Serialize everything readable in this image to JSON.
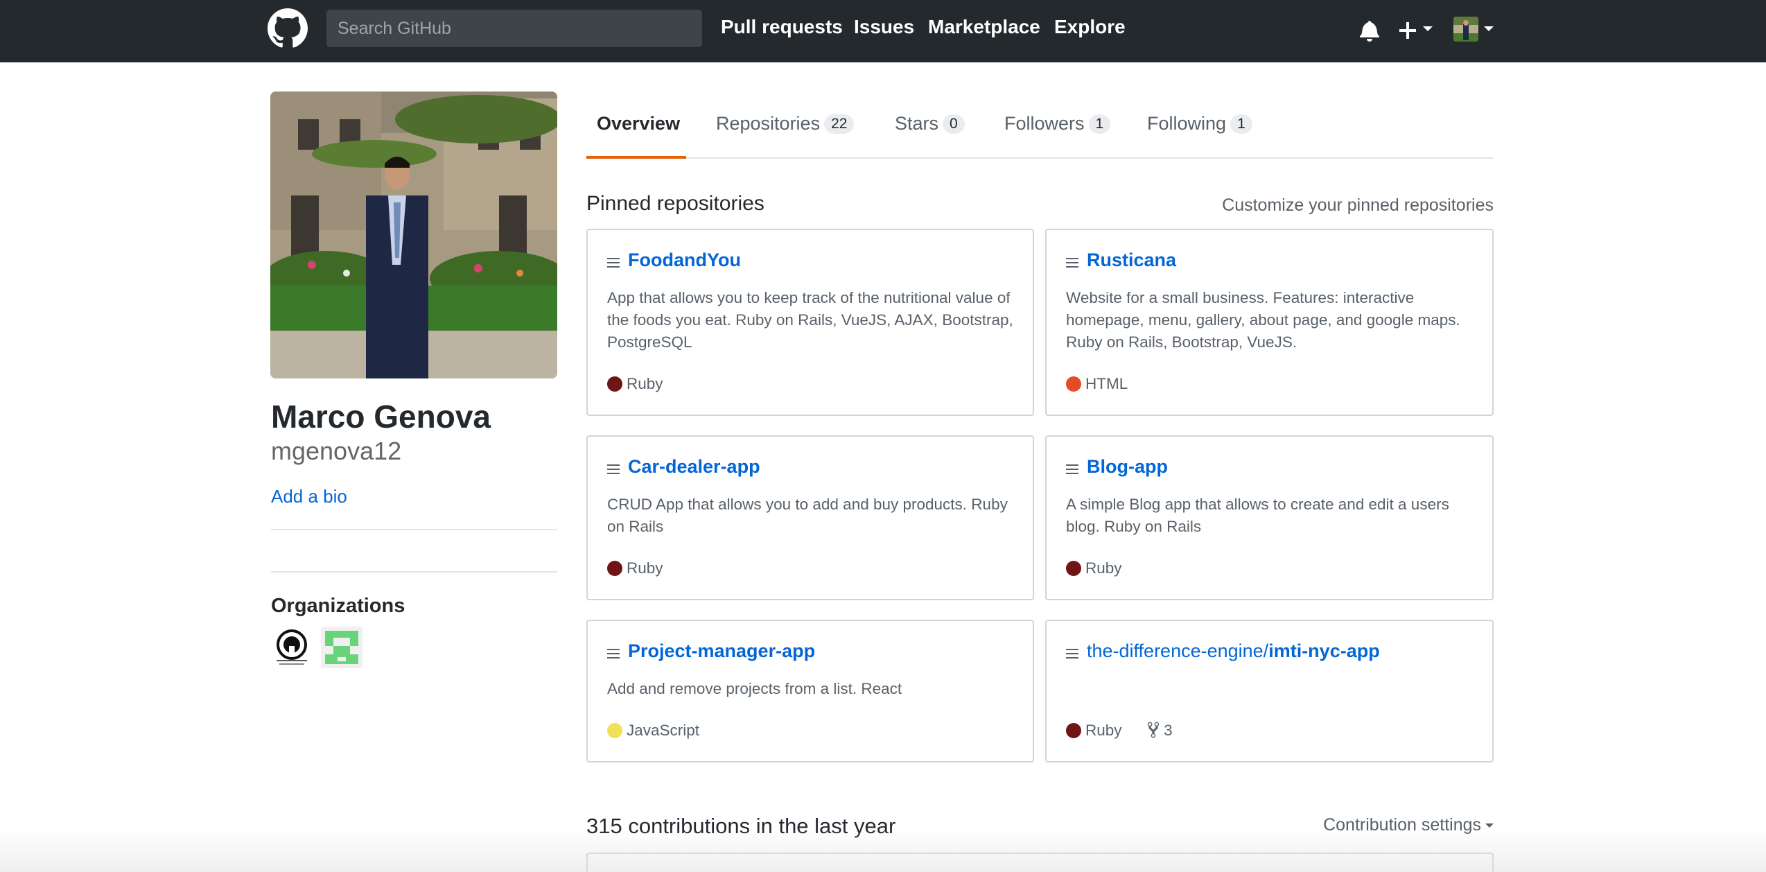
{
  "header": {
    "search_placeholder": "Search GitHub",
    "nav": [
      "Pull requests",
      "Issues",
      "Marketplace",
      "Explore"
    ],
    "icons": [
      "github-logo-icon",
      "bell-icon",
      "plus-icon",
      "avatar"
    ]
  },
  "profile": {
    "fullname": "Marco Genova",
    "username": "mgenova12",
    "add_bio": "Add a bio",
    "organizations_title": "Organizations"
  },
  "tabs": [
    {
      "label": "Overview",
      "count": null,
      "active": true
    },
    {
      "label": "Repositories",
      "count": "22"
    },
    {
      "label": "Stars",
      "count": "0"
    },
    {
      "label": "Followers",
      "count": "1"
    },
    {
      "label": "Following",
      "count": "1"
    }
  ],
  "pinned": {
    "title": "Pinned repositories",
    "customize": "Customize your pinned repositories",
    "repos": [
      {
        "name": "FoodandYou",
        "desc": "App that allows you to keep track of the nutritional value of the foods you eat. Ruby on Rails, VueJS, AJAX, Bootstrap, PostgreSQL",
        "lang": "Ruby",
        "color": "#701516"
      },
      {
        "name": "Rusticana",
        "desc": "Website for a small business. Features: interactive homepage, menu, gallery, about page, and google maps. Ruby on Rails, Bootstrap, VueJS.",
        "lang": "HTML",
        "color": "#e34c26"
      },
      {
        "name": "Car-dealer-app",
        "desc": "CRUD App that allows you to add and buy products. Ruby on Rails",
        "lang": "Ruby",
        "color": "#701516"
      },
      {
        "name": "Blog-app",
        "desc": "A simple Blog app that allows to create and edit a users blog. Ruby on Rails",
        "lang": "Ruby",
        "color": "#701516"
      },
      {
        "name": "Project-manager-app",
        "desc": "Add and remove projects from a list. React",
        "lang": "JavaScript",
        "color": "#f1e05a"
      },
      {
        "owner": "the-difference-engine/",
        "name": "imti-nyc-app",
        "desc": "",
        "lang": "Ruby",
        "color": "#701516",
        "forks": "3"
      }
    ]
  },
  "contributions": {
    "title": "315 contributions in the last year",
    "settings": "Contribution settings"
  }
}
